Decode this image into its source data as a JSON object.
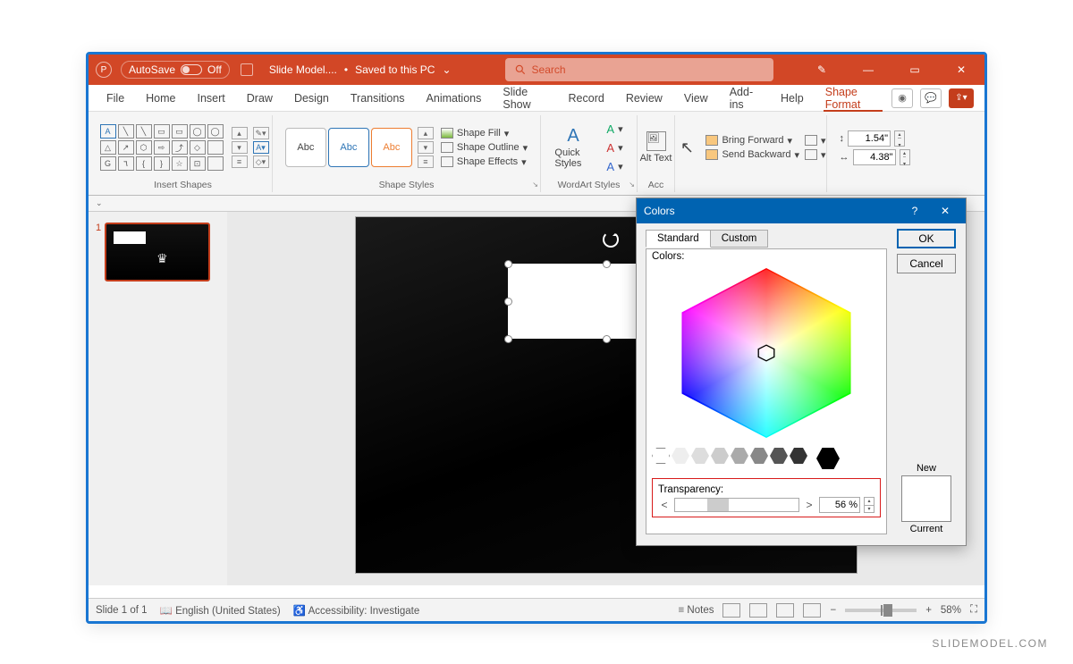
{
  "titlebar": {
    "autosave_label": "AutoSave",
    "autosave_state": "Off",
    "doc_name": "Slide Model....",
    "saved_state": "Saved to this PC",
    "search_placeholder": "Search"
  },
  "ribbon_tabs": {
    "items": [
      "File",
      "Home",
      "Insert",
      "Draw",
      "Design",
      "Transitions",
      "Animations",
      "Slide Show",
      "Record",
      "Review",
      "View",
      "Add-ins",
      "Help",
      "Shape Format"
    ],
    "active": "Shape Format"
  },
  "ribbon": {
    "insert_shapes_label": "Insert Shapes",
    "shape_styles_label": "Shape Styles",
    "wordart_label": "WordArt Styles",
    "acc_label": "Acc",
    "shape_fill": "Shape Fill",
    "shape_outline": "Shape Outline",
    "shape_effects": "Shape Effects",
    "quick_styles": "Quick Styles",
    "alt_text": "Alt Text",
    "bring_forward": "Bring Forward",
    "send_backward": "Send Backward",
    "height": "1.54\"",
    "width": "4.38\"",
    "abc": "Abc"
  },
  "colors_dialog": {
    "title": "Colors",
    "tab_standard": "Standard",
    "tab_custom": "Custom",
    "colors_label": "Colors:",
    "transparency_label": "Transparency:",
    "transparency_value": "56 %",
    "ok": "OK",
    "cancel": "Cancel",
    "new_label": "New",
    "current_label": "Current"
  },
  "status": {
    "slide_counter": "Slide 1 of 1",
    "language": "English (United States)",
    "accessibility": "Accessibility: Investigate",
    "notes": "Notes",
    "zoom": "58%"
  },
  "thumb": {
    "index": "1"
  },
  "watermark": "SLIDEMODEL.COM"
}
